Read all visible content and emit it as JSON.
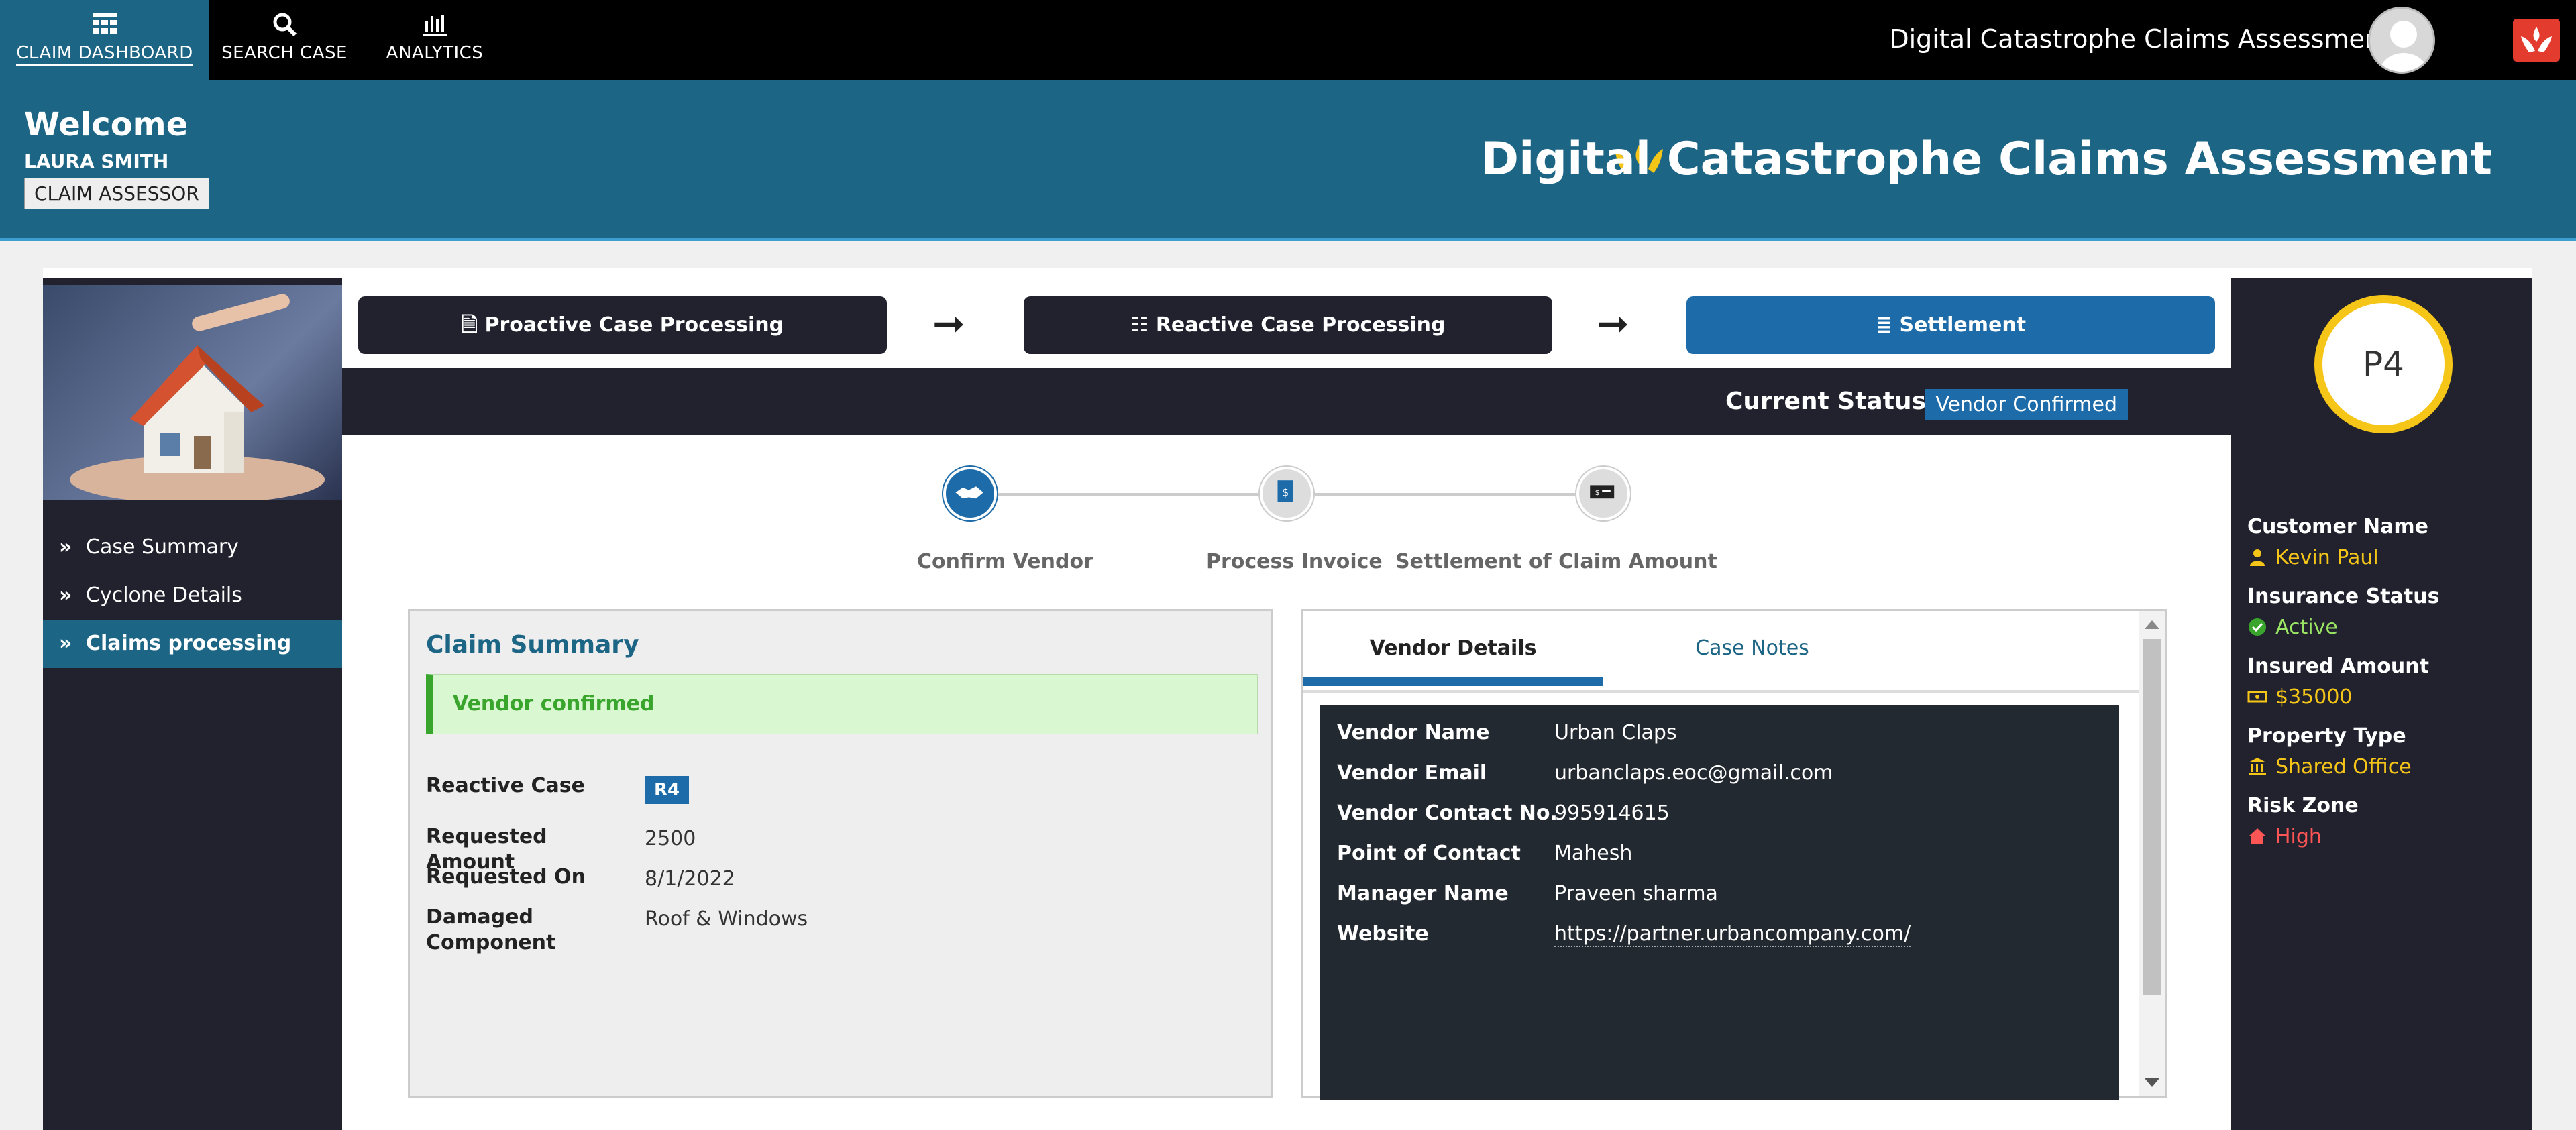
{
  "nav": {
    "items": [
      {
        "label": "CLAIM DASHBOARD",
        "icon": "dashboard-grid-icon"
      },
      {
        "label": "SEARCH CASE",
        "icon": "search-icon"
      },
      {
        "label": "ANALYTICS",
        "icon": "bar-chart-icon"
      }
    ],
    "app_selector": "Digital Catastrophe Claims Assessment ▾"
  },
  "header": {
    "welcome": "Welcome",
    "user_name": "LAURA SMITH",
    "role": "CLAIM ASSESSOR",
    "title": "Digital Catastrophe Claims Assessment"
  },
  "sidebar": {
    "items": [
      {
        "label": "Case Summary"
      },
      {
        "label": "Cyclone Details"
      },
      {
        "label": "Claims processing"
      }
    ]
  },
  "steps": {
    "items": [
      {
        "label": "Proactive Case Processing",
        "icon": "document-icon"
      },
      {
        "label": "Reactive Case Processing",
        "icon": "checklist-icon"
      },
      {
        "label": "Settlement",
        "icon": "list-icon"
      }
    ],
    "arrow": "➞"
  },
  "status": {
    "label": "Current Status",
    "value": "Vendor Confirmed"
  },
  "timeline": {
    "steps": [
      {
        "label": "Confirm Vendor",
        "icon": "handshake-icon"
      },
      {
        "label": "Process Invoice",
        "icon": "invoice-icon"
      },
      {
        "label": "Settlement of Claim Amount",
        "icon": "cheque-icon"
      }
    ]
  },
  "claim": {
    "title": "Claim Summary",
    "message": "Vendor confirmed",
    "reactive_case_label": "Reactive Case",
    "reactive_case_value": "R4",
    "requested_amount_label": "Requested Amount",
    "requested_amount": "2500",
    "requested_on_label": "Requested On",
    "requested_on": "8/1/2022",
    "damaged_label": "Damaged Component",
    "damaged": "Roof & Windows"
  },
  "vendor": {
    "tabs": [
      "Vendor Details",
      "Case Notes"
    ],
    "rows": [
      {
        "k": "Vendor Name",
        "v": "Urban Claps"
      },
      {
        "k": "Vendor Email",
        "v": "urbanclaps.eoc@gmail.com"
      },
      {
        "k": "Vendor Contact No.",
        "v": "995914615"
      },
      {
        "k": "Point of Contact",
        "v": "Mahesh"
      },
      {
        "k": "Manager Name",
        "v": "Praveen sharma"
      },
      {
        "k": "Website",
        "v": "https://partner.urbancompany.com/"
      }
    ]
  },
  "customer": {
    "priority": "P4",
    "name_label": "Customer Name",
    "name": "Kevin Paul",
    "insurance_label": "Insurance Status",
    "insurance": "Active",
    "amount_label": "Insured Amount",
    "amount": "$35000",
    "property_label": "Property Type",
    "property": "Shared Office",
    "risk_label": "Risk Zone",
    "risk": "High"
  },
  "colors": {
    "primary": "#1d6585",
    "accent_blue": "#1d6ba8",
    "dark_panel": "#22222f",
    "yellow": "#f5c518",
    "success": "#3aa52d"
  }
}
